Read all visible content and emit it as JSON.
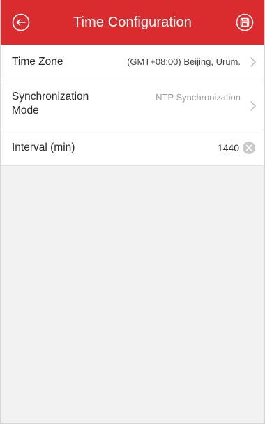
{
  "header": {
    "title": "Time Configuration",
    "back_icon": "back-arrow-icon",
    "save_icon": "save-icon",
    "bg_color": "#da2b2e"
  },
  "settings": {
    "time_zone": {
      "label": "Time Zone",
      "value": "(GMT+08:00) Beijing, Urum."
    },
    "sync_mode": {
      "label": "Synchronization Mode",
      "value": "NTP Synchronization"
    },
    "interval": {
      "label": "Interval (min)",
      "value": "1440"
    }
  }
}
